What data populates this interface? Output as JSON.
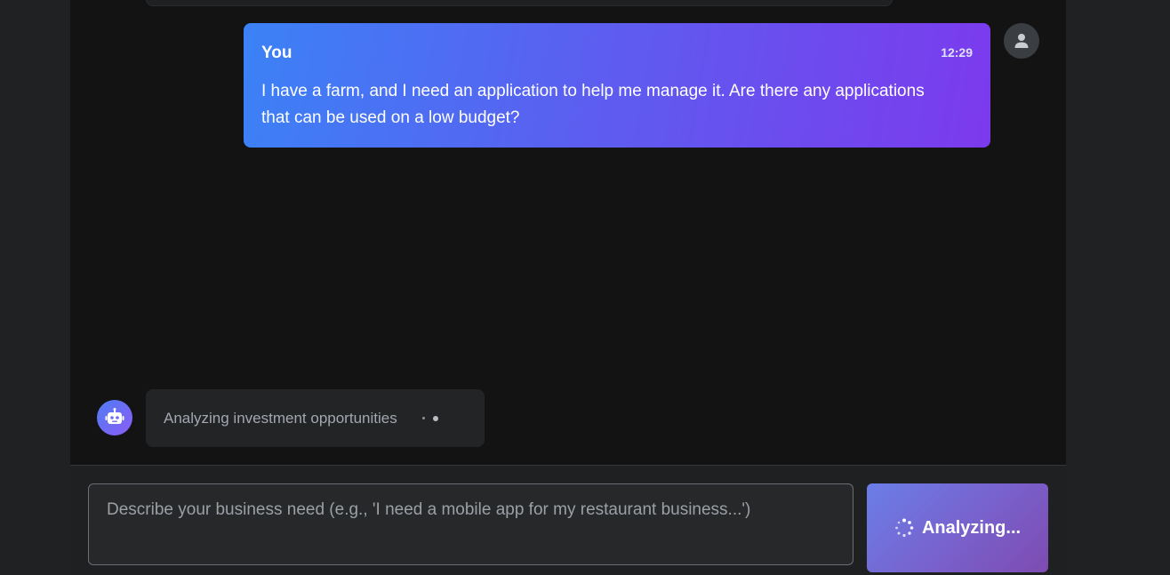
{
  "conversation": {
    "user_message": {
      "sender": "You",
      "time": "12:29",
      "text": "I have a farm, and I need an application to help me manage it. Are there any applications that can be used on a low budget?"
    },
    "bot_status": {
      "text": "Analyzing investment opportunities"
    }
  },
  "composer": {
    "placeholder": "Describe your business need (e.g., 'I need a mobile app for my restaurant business...')",
    "value": "",
    "button_label": "Analyzing..."
  },
  "icons": {
    "user_avatar": "user-icon",
    "bot_avatar": "robot-icon",
    "button_spinner": "spinner-icon"
  },
  "colors": {
    "user_bubble_start": "#3b82f6",
    "user_bubble_end": "#7c3aed",
    "button_start": "#6b7ee8",
    "button_end": "#7d4bb0"
  }
}
